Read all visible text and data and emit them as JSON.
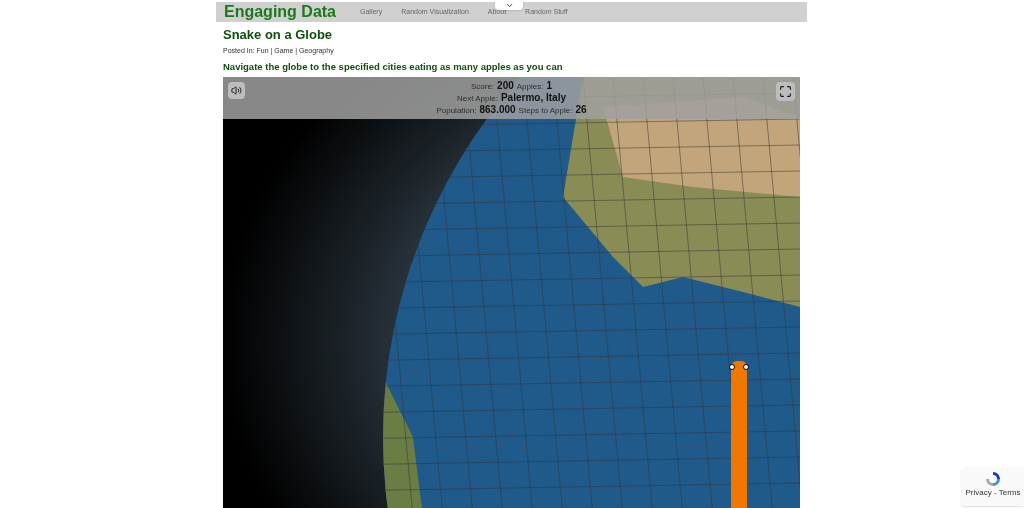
{
  "site": {
    "title": "Engaging Data",
    "nav": [
      {
        "label": "Gallery"
      },
      {
        "label": "Random Visualization"
      },
      {
        "label": "About"
      },
      {
        "label": "Random Stuff"
      }
    ]
  },
  "post": {
    "title": "Snake on a Globe",
    "posted_in": "Posted In: Fun | Game | Geography",
    "subtitle": "Navigate the globe to the specified cities eating as many apples as you can"
  },
  "game": {
    "stats": [
      [
        {
          "label": "Score:",
          "value": "200"
        },
        {
          "label": "Apples:",
          "value": "1"
        }
      ],
      [
        {
          "label": "Next Apple:",
          "value": "Palermo, Italy"
        }
      ],
      [
        {
          "label": "Population:",
          "value": "863.000"
        },
        {
          "label": "Steps to Apple:",
          "value": "26"
        }
      ]
    ]
  },
  "recaptcha": {
    "text": "Privacy - Terms"
  }
}
